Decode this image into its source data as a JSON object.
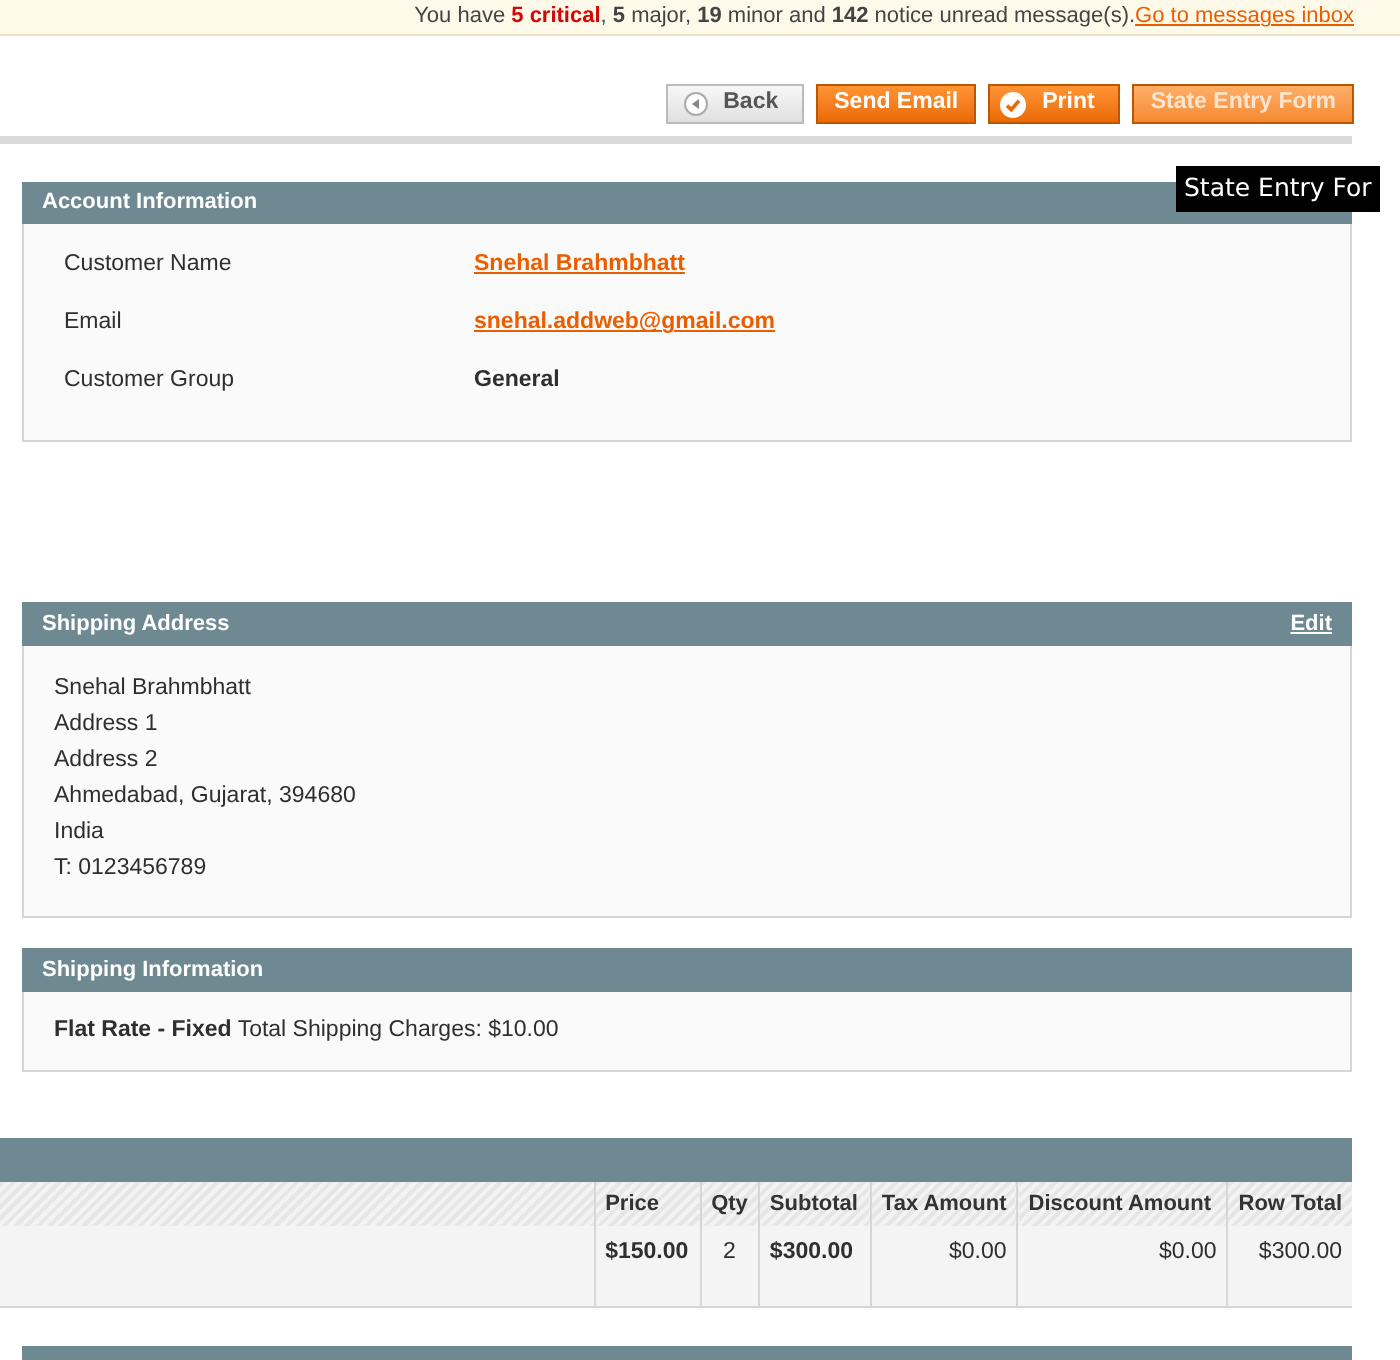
{
  "notice": {
    "segments": [
      {
        "text": "You have ",
        "kind": "plain"
      },
      {
        "text": "5 critical",
        "kind": "critical"
      },
      {
        "text": ", ",
        "kind": "plain"
      },
      {
        "text": "5",
        "kind": "bold"
      },
      {
        "text": " major, ",
        "kind": "plain"
      },
      {
        "text": "19",
        "kind": "bold"
      },
      {
        "text": " minor and ",
        "kind": "plain"
      },
      {
        "text": "142",
        "kind": "bold"
      },
      {
        "text": " notice unread message(s). ",
        "kind": "plain"
      }
    ],
    "link": "Go to messages inbox"
  },
  "buttons": [
    {
      "label": "Back",
      "kind": "back"
    },
    {
      "label": "Send Email",
      "kind": "primary"
    },
    {
      "label": "Print",
      "kind": "print"
    },
    {
      "label": "State Entry Form",
      "kind": "hover"
    }
  ],
  "tooltip": "State Entry For",
  "account": {
    "title": "Account Information",
    "fields": [
      {
        "label": "Customer Name",
        "value": "Snehal Brahmbhatt",
        "kind": "link"
      },
      {
        "label": "Email",
        "value": "snehal.addweb@gmail.com",
        "kind": "link"
      },
      {
        "label": "Customer Group",
        "value": "General",
        "kind": "text"
      }
    ]
  },
  "shipping_address": {
    "title": "Shipping Address",
    "action": "Edit",
    "lines": [
      "Snehal Brahmbhatt",
      "Address 1",
      "Address 2",
      "Ahmedabad, Gujarat, 394680",
      "India",
      "T: 0123456789"
    ]
  },
  "shipping_information": {
    "title": "Shipping Information",
    "text": "**Flat Rate - Fixed** Total Shipping Charges: $10.00"
  },
  "items": {
    "columns": [
      "Price",
      "Qty",
      "Subtotal",
      "Tax Amount",
      "Discount Amount",
      "Row Total"
    ],
    "rows": [
      [
        {
          "text": "$150.00",
          "bold": true
        },
        {
          "text": "2",
          "bold": false
        },
        {
          "text": "$300.00",
          "bold": true
        },
        {
          "text": "$0.00",
          "bold": false
        },
        {
          "text": "$0.00",
          "bold": false
        },
        {
          "text": "$300.00",
          "bold": false
        }
      ]
    ]
  }
}
